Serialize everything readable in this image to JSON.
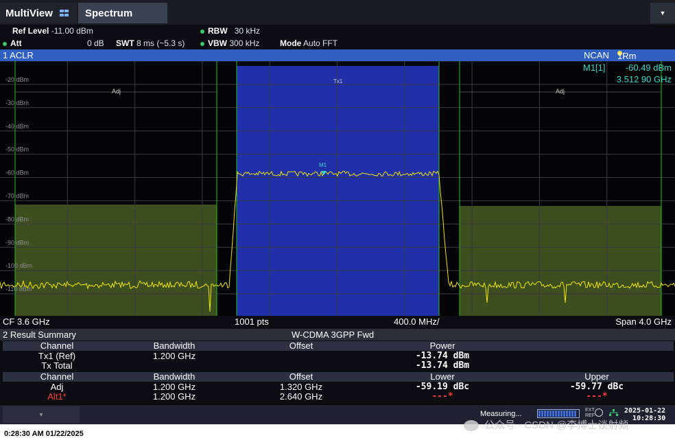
{
  "tabs": {
    "multiview": "MultiView",
    "spectrum": "Spectrum",
    "menu_icon": "dropdown-icon"
  },
  "params": {
    "ref_level_label": "Ref Level",
    "ref_level_value": "-11.00 dBm",
    "att_label": "Att",
    "att_value": "0 dB",
    "swt_label": "SWT",
    "swt_value": "8 ms (~5.3 s)",
    "rbw_label": "RBW",
    "rbw_value": "30 kHz",
    "vbw_label": "VBW",
    "vbw_value": "300 kHz",
    "mode_label": "Mode",
    "mode_value": "Auto FFT"
  },
  "aclr": {
    "title": "1 ACLR",
    "ncan": "NCAN",
    "trace": "1Rm Clrw"
  },
  "marker": {
    "label": "M1[1]",
    "level": "-60.49 dBm",
    "freq": "3.512 90 GHz",
    "tag": "M1"
  },
  "plot": {
    "y_labels": [
      "-20 dBm",
      "-30 dBm",
      "-40 dBm",
      "-50 dBm",
      "-60 dBm",
      "-70 dBm",
      "-80 dBm",
      "-90 dBm",
      "-100 dBm",
      "-110 dBm"
    ],
    "ch_tx": "Tx1",
    "ch_adj_left": "Adj",
    "ch_adj_right": "Adj",
    "colors": {
      "trace": "#f2e600",
      "tx_fill": "#2130a8",
      "adj_fill": "#3d4f1e",
      "channel_line": "#23c023",
      "grid": "#3a3a44",
      "marker": "#3ad6c8"
    }
  },
  "axis": {
    "cf": "CF 3.6 GHz",
    "pts": "1001 pts",
    "div": "400.0 MHz/",
    "span": "Span 4.0 GHz"
  },
  "summary": {
    "title": "2 Result Summary",
    "standard": "W-CDMA 3GPP Fwd",
    "header1": {
      "channel": "Channel",
      "bandwidth": "Bandwidth",
      "offset": "Offset",
      "power": "Power"
    },
    "tx1": {
      "channel": "Tx1 (Ref)",
      "bandwidth": "1.200 GHz",
      "power": "-13.74 dBm"
    },
    "txtotal": {
      "channel": "Tx Total",
      "power": "-13.74 dBm"
    },
    "header2": {
      "channel": "Channel",
      "bandwidth": "Bandwidth",
      "offset": "Offset",
      "lower": "Lower",
      "upper": "Upper"
    },
    "adj": {
      "channel": "Adj",
      "bandwidth": "1.200 GHz",
      "offset": "1.320 GHz",
      "lower": "-59.19 dBc",
      "upper": "-59.77 dBc"
    },
    "alt1": {
      "channel": "Alt1*",
      "bandwidth": "1.200 GHz",
      "offset": "2.640 GHz",
      "lower": "---*",
      "upper": "---*"
    }
  },
  "status": {
    "measuring": "Measuring...",
    "ext_top": "EXT",
    "ext_bottom": "REF",
    "date": "2025-01-22",
    "time": "10:28:30"
  },
  "footer": {
    "timestamp": "0:28:30 AM 01/22/2025",
    "watermark": "公众号 · CSDN @李博士谈射频"
  }
}
